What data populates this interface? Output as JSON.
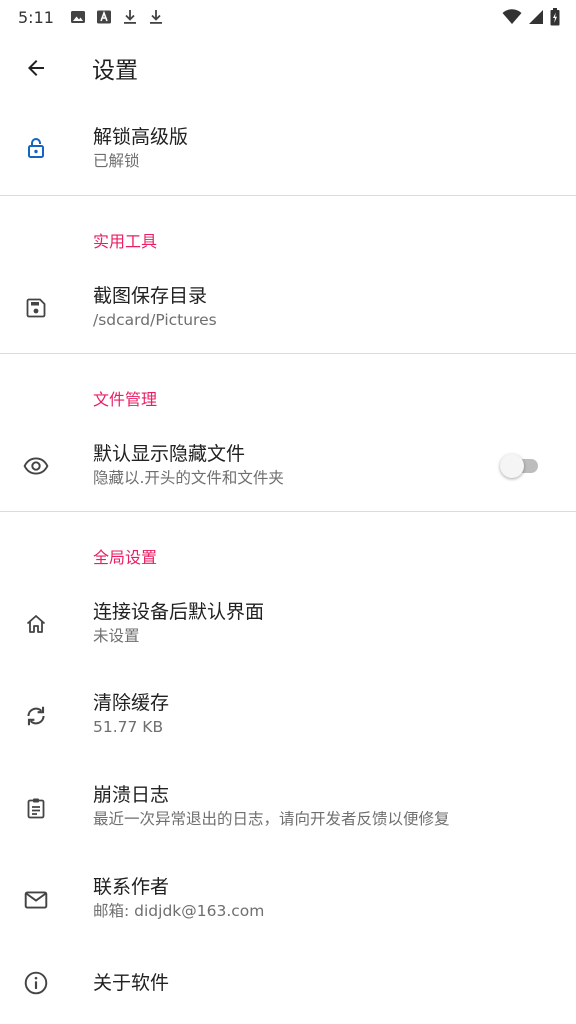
{
  "status_bar": {
    "time": "5:11",
    "left_icons": [
      "image-icon",
      "a-box-icon",
      "download-icon",
      "download-icon"
    ],
    "right_icons": [
      "wifi-icon",
      "signal-icon",
      "battery-icon"
    ]
  },
  "app_bar": {
    "title": "设置",
    "back_icon": "arrow-back-icon"
  },
  "accent_color": "#e91e63",
  "unlock": {
    "title": "解锁高级版",
    "summary": "已解锁",
    "icon": "lock-open-icon",
    "icon_color": "#1565c0"
  },
  "tools": {
    "header": "实用工具",
    "screenshot_dir": {
      "title": "截图保存目录",
      "summary": "/sdcard/Pictures",
      "icon": "save-icon"
    }
  },
  "files": {
    "header": "文件管理",
    "show_hidden": {
      "title": "默认显示隐藏文件",
      "summary": "隐藏以.开头的文件和文件夹",
      "icon": "eye-icon",
      "enabled": false
    }
  },
  "global": {
    "header": "全局设置",
    "default_screen": {
      "title": "连接设备后默认界面",
      "summary": "未设置",
      "icon": "home-icon"
    },
    "clear_cache": {
      "title": "清除缓存",
      "summary": "51.77 KB",
      "icon": "sync-icon"
    },
    "crash_log": {
      "title": "崩溃日志",
      "summary": "最近一次异常退出的日志，请向开发者反馈以便修复",
      "icon": "clipboard-icon"
    },
    "contact": {
      "title": "联系作者",
      "summary": "邮箱: didjdk@163.com",
      "icon": "mail-icon"
    },
    "about": {
      "title": "关于软件",
      "icon": "info-icon"
    }
  }
}
